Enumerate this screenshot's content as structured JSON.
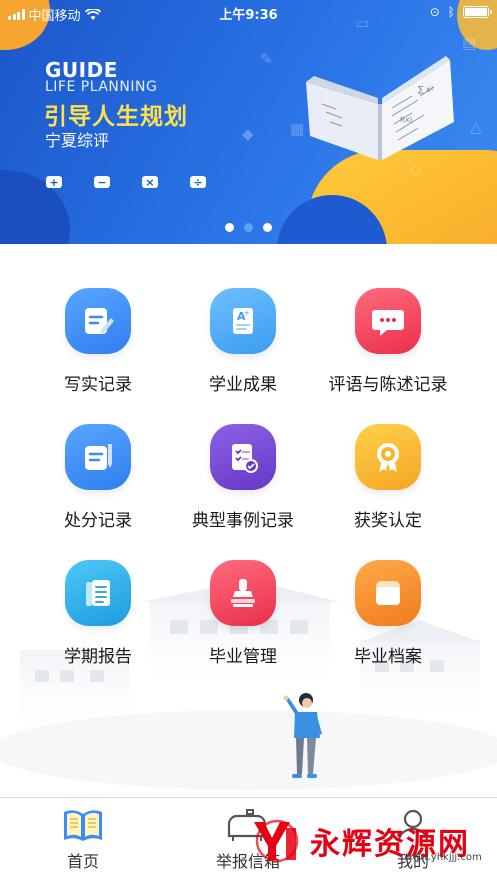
{
  "status_bar": {
    "carrier": "中国移动",
    "time": "上午9:36",
    "signal_bars": 4,
    "battery_level": 1.0
  },
  "banner": {
    "guide": "GUIDE",
    "life_planning": "LIFE PLANNING",
    "slogan": "引导人生规划",
    "subtitle": "宁夏综评",
    "operators": [
      "+",
      "−",
      "×",
      "÷"
    ],
    "page_count": 3,
    "active_page": 1
  },
  "menu": [
    {
      "label": "写实记录",
      "icon": "edit-note-icon",
      "color": "#3b8df5"
    },
    {
      "label": "学业成果",
      "icon": "grade-document-icon",
      "color": "#41a7f5"
    },
    {
      "label": "评语与陈述记录",
      "icon": "chat-bubble-icon",
      "color": "#f0435a"
    },
    {
      "label": "处分记录",
      "icon": "notebook-pen-icon",
      "color": "#3b8df5"
    },
    {
      "label": "典型事例记录",
      "icon": "checklist-icon",
      "color": "#7a4fd1"
    },
    {
      "label": "获奖认定",
      "icon": "medal-icon",
      "color": "#f7b52c"
    },
    {
      "label": "学期报告",
      "icon": "report-book-icon",
      "color": "#2fb2ea"
    },
    {
      "label": "毕业管理",
      "icon": "stamp-icon",
      "color": "#f0435a"
    },
    {
      "label": "毕业档案",
      "icon": "archive-folder-icon",
      "color": "#f58a2c"
    }
  ],
  "tabbar": {
    "tabs": [
      {
        "label": "首页",
        "icon": "book-home-icon",
        "active": true
      },
      {
        "label": "举报信箱",
        "icon": "mailbox-icon",
        "active": false
      },
      {
        "label": "我的",
        "icon": "user-icon",
        "active": false
      }
    ]
  },
  "watermark": {
    "brand": "永辉资源网",
    "url": "www.yhkjjj.com"
  },
  "colors": {
    "banner_blue": "#2a6ee0",
    "slogan_yellow": "#ffe14d",
    "accent_blue": "#3b8df5"
  }
}
